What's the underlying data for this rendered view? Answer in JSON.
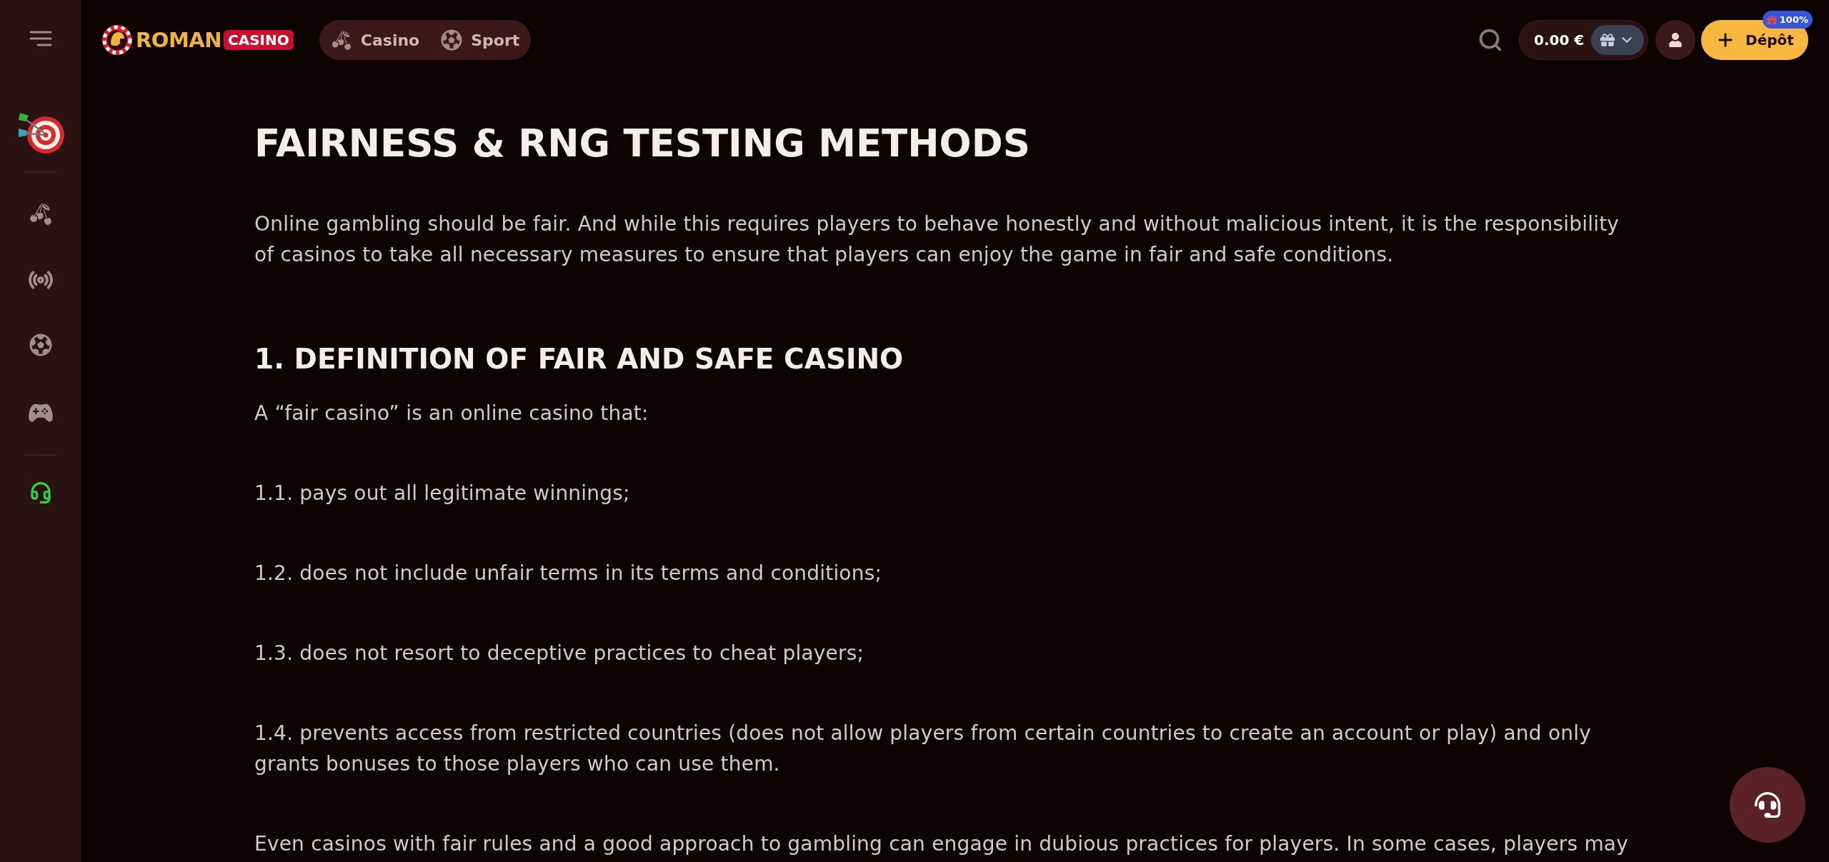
{
  "header": {
    "logo": {
      "text": "ROMAN",
      "tag": "CASINO"
    },
    "nav": [
      {
        "label": "Casino"
      },
      {
        "label": "Sport"
      }
    ],
    "balance": "0.00 €",
    "deposit": {
      "label": "Dépôt",
      "badge": "100%"
    }
  },
  "article": {
    "title": "FAIRNESS & RNG TESTING METHODS",
    "intro": "Online gambling should be fair. And while this requires players to behave honestly and without malicious intent, it is the responsibility of casinos to take all necessary measures to ensure that players can enjoy the game in fair and safe conditions.",
    "sections": [
      {
        "heading": "1. DEFINITION OF FAIR AND SAFE CASINO",
        "paragraphs": [
          "A “fair casino” is an online casino that:",
          "1.1. pays out all legitimate winnings;",
          "1.2. does not include unfair terms in its terms and conditions;",
          "1.3. does not resort to deceptive practices to cheat players;",
          "1.4. prevents access from restricted countries (does not allow players from certain countries to create an account or play) and only grants bonuses to those players who can use them.",
          "Even casinos with fair rules and a good approach to gambling can engage in dubious practices for players. In some cases, players may"
        ]
      }
    ]
  }
}
